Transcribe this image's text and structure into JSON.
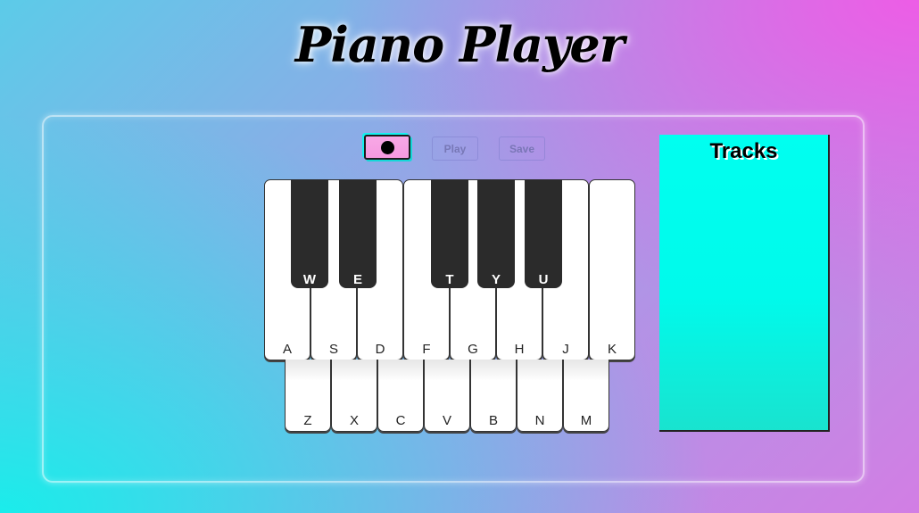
{
  "app": {
    "title": "Piano Player"
  },
  "controls": {
    "record_icon": "record-dot",
    "play_label": "Play",
    "save_label": "Save"
  },
  "piano": {
    "white_keys": [
      "A",
      "S",
      "D",
      "F",
      "G",
      "H",
      "J",
      "K"
    ],
    "black_keys": [
      "W",
      "E",
      "T",
      "Y",
      "U"
    ],
    "lower_keys": [
      "Z",
      "X",
      "C",
      "V",
      "B",
      "N",
      "M"
    ]
  },
  "tracks": {
    "title": "Tracks",
    "items": []
  },
  "colors": {
    "record_button": "#f7a8e6",
    "tracks_panel": "#00fff0",
    "black_key": "#2b2b2b"
  }
}
